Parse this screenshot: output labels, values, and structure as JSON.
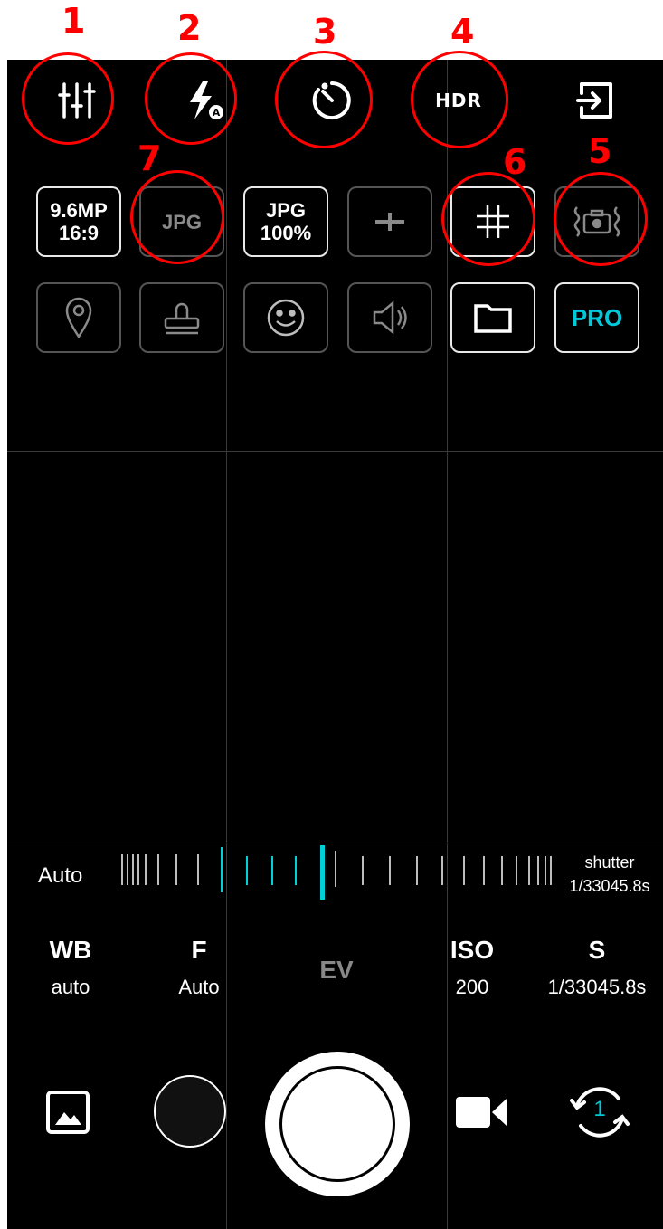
{
  "annotations": [
    "1",
    "2",
    "3",
    "4",
    "5",
    "6",
    "7"
  ],
  "top_bar": {
    "settings_icon": "sliders-icon",
    "flash_icon": "flash-auto-icon",
    "timer_icon": "timer-icon",
    "hdr_label": "HDR",
    "exit_icon": "exit-icon"
  },
  "quick_row1": {
    "resolution_line1": "9.6MP",
    "resolution_line2": "16:9",
    "format_label": "JPG",
    "quality_line1": "JPG",
    "quality_line2": "100%"
  },
  "quick_row2": {
    "pro_label": "PRO"
  },
  "slider": {
    "left_label": "Auto",
    "right_label": "shutter",
    "right_value": "1/33045.8s"
  },
  "params": [
    {
      "label": "WB",
      "value": "auto"
    },
    {
      "label": "F",
      "value": "Auto"
    },
    {
      "label": "EV",
      "value": ""
    },
    {
      "label": "ISO",
      "value": "200"
    },
    {
      "label": "S",
      "value": "1/33045.8s"
    }
  ],
  "bottom": {
    "switch_camera_badge": "1"
  },
  "colors": {
    "accent": "#00d0d8",
    "annotation": "#ff0000",
    "background": "#000000"
  }
}
